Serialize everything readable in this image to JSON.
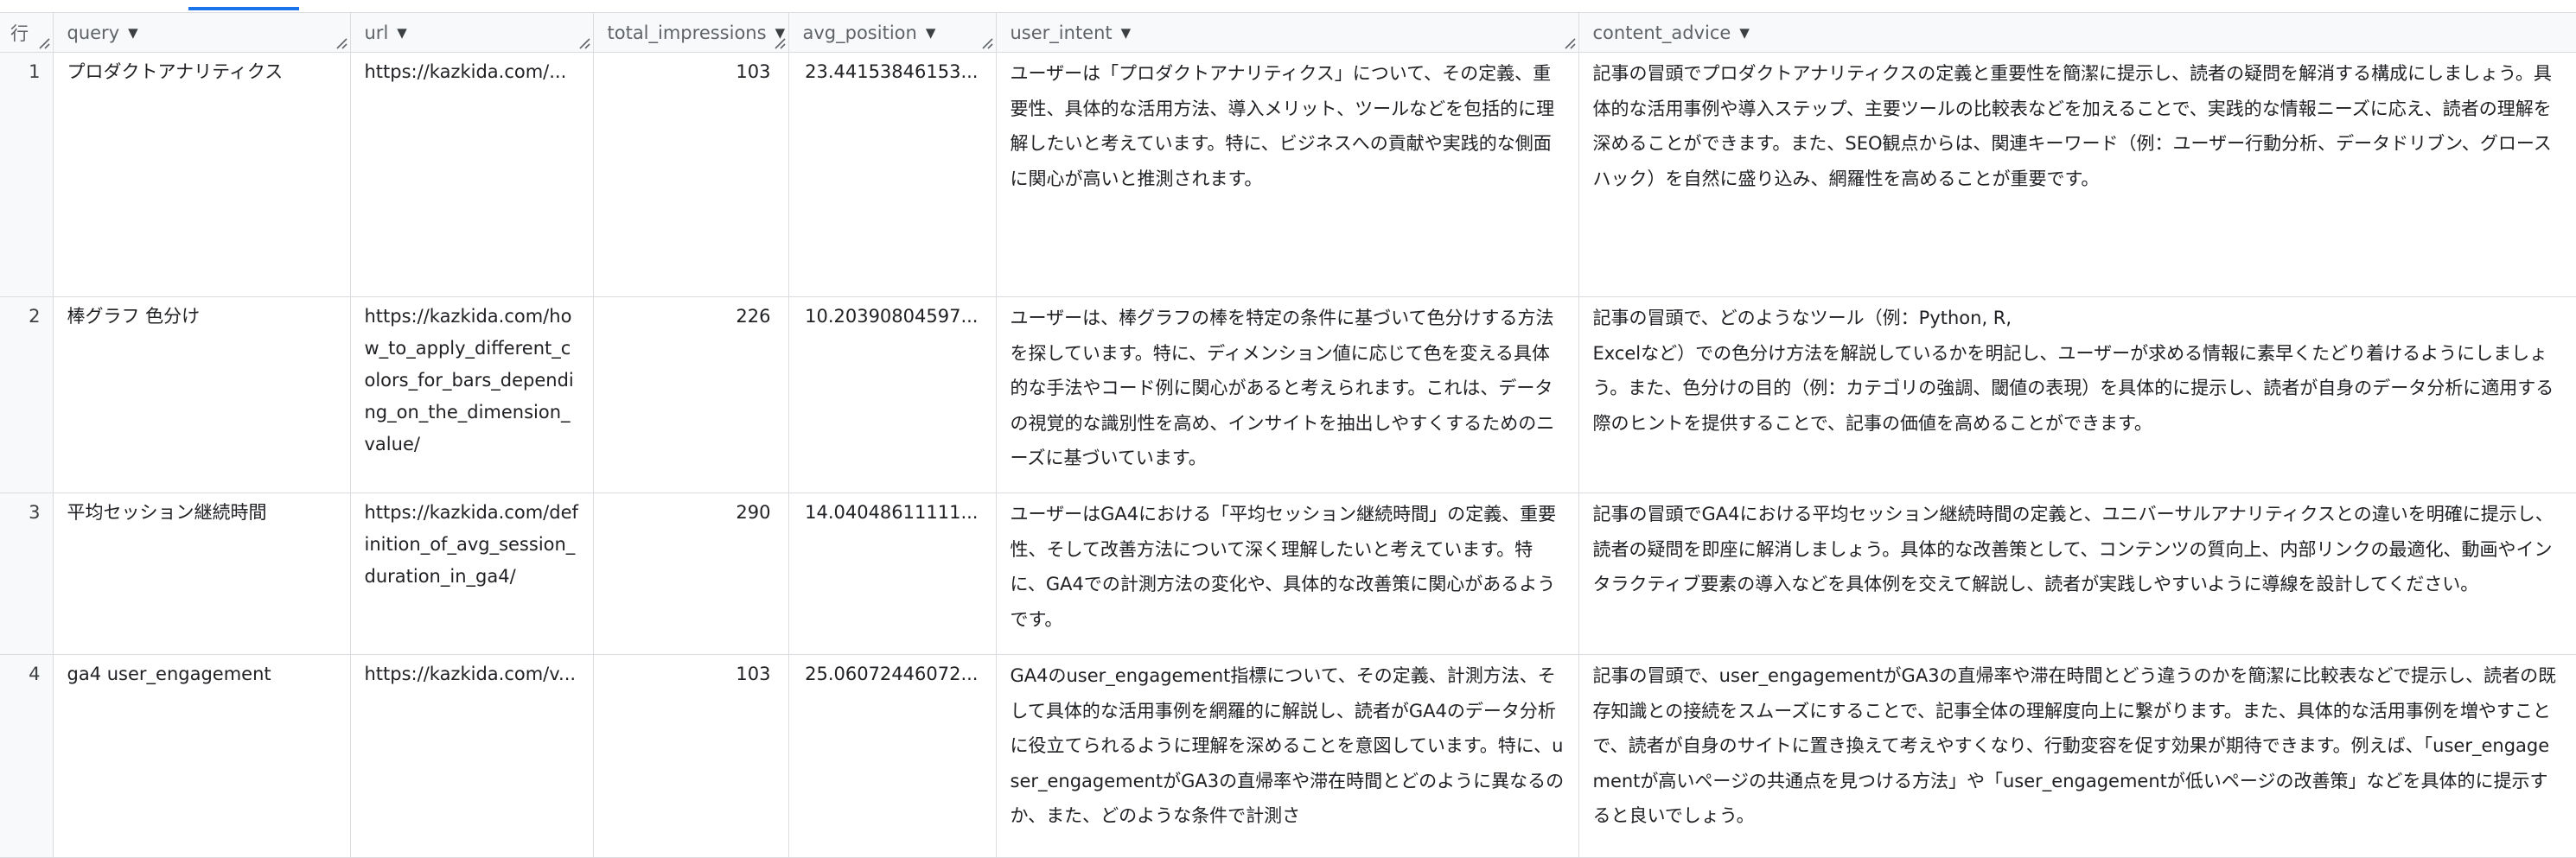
{
  "columns": [
    {
      "label": "行"
    },
    {
      "label": "query"
    },
    {
      "label": "url"
    },
    {
      "label": "total_impressions"
    },
    {
      "label": "avg_position"
    },
    {
      "label": "user_intent"
    },
    {
      "label": "content_advice"
    }
  ],
  "rows": [
    {
      "row": "1",
      "query": "プロダクトアナリティクス",
      "url": "https://kazkida.com/...",
      "total_impressions": "103",
      "avg_position": "23.44153846153...",
      "user_intent": "ユーザーは「プロダクトアナリティクス」について、その定義、重要性、具体的な活用方法、導入メリット、ツールなどを包括的に理解したいと考えています。特に、ビジネスへの貢献や実践的な側面に関心が高いと推測されます。",
      "content_advice": "記事の冒頭でプロダクトアナリティクスの定義と重要性を簡潔に提示し、読者の疑問を解消する構成にしましょう。具体的な活用事例や導入ステップ、主要ツールの比較表などを加えることで、実践的な情報ニーズに応え、読者の理解を深めることができます。また、SEO観点からは、関連キーワード（例：ユーザー行動分析、データドリブン、グロースハック）を自然に盛り込み、網羅性を高めることが重要です。"
    },
    {
      "row": "2",
      "query": "棒グラフ 色分け",
      "url": "https://kazkida.com/how_to_apply_different_colors_for_bars_depending_on_the_dimension_value/",
      "total_impressions": "226",
      "avg_position": "10.20390804597...",
      "user_intent": "ユーザーは、棒グラフの棒を特定の条件に基づいて色分けする方法を探しています。特に、ディメンション値に応じて色を変える具体的な手法やコード例に関心があると考えられます。これは、データの視覚的な識別性を高め、インサイトを抽出しやすくするためのニーズに基づいています。",
      "content_advice_lines": [
        "記事の冒頭で、どのようなツール（例：Python, R,",
        "Excelなど）での色分け方法を解説しているかを明記し、ユーザーが求める情報に素早くたどり着けるようにしましょう。また、色分けの目的（例：カテゴリの強調、閾値の表現）を具体的に提示し、読者が自身のデータ分析に適用する際のヒントを提供することで、記事の価値を高めることができます。"
      ]
    },
    {
      "row": "3",
      "query": "平均セッション継続時間",
      "url": "https://kazkida.com/definition_of_avg_session_duration_in_ga4/",
      "total_impressions": "290",
      "avg_position": "14.04048611111...",
      "user_intent": "ユーザーはGA4における「平均セッション継続時間」の定義、重要性、そして改善方法について深く理解したいと考えています。特に、GA4での計測方法の変化や、具体的な改善策に関心があるようです。",
      "content_advice": "記事の冒頭でGA4における平均セッション継続時間の定義と、ユニバーサルアナリティクスとの違いを明確に提示し、読者の疑問を即座に解消しましょう。具体的な改善策として、コンテンツの質向上、内部リンクの最適化、動画やインタラクティブ要素の導入などを具体例を交えて解説し、読者が実践しやすいように導線を設計してください。"
    },
    {
      "row": "4",
      "query": "ga4 user_engagement",
      "url": "https://kazkida.com/v...",
      "total_impressions": "103",
      "avg_position": "25.06072446072...",
      "user_intent": "GA4のuser_engagement指標について、その定義、計測方法、そして具体的な活用事例を網羅的に解説し、読者がGA4のデータ分析に役立てられるように理解を深めることを意図しています。特に、user_engagementがGA3の直帰率や滞在時間とどのように異なるのか、また、どのような条件で計測さ",
      "content_advice": "記事の冒頭で、user_engagementがGA3の直帰率や滞在時間とどう違うのかを簡潔に比較表などで提示し、読者の既存知識との接続をスムーズにすることで、記事全体の理解度向上に繋がります。また、具体的な活用事例を増やすことで、読者が自身のサイトに置き換えて考えやすくなり、行動変容を促す効果が期待できます。例えば、「user_engagementが高いページの共通点を見つける方法」や「user_engagementが低いページの改善策」などを具体的に提示すると良いでしょう。"
    }
  ]
}
